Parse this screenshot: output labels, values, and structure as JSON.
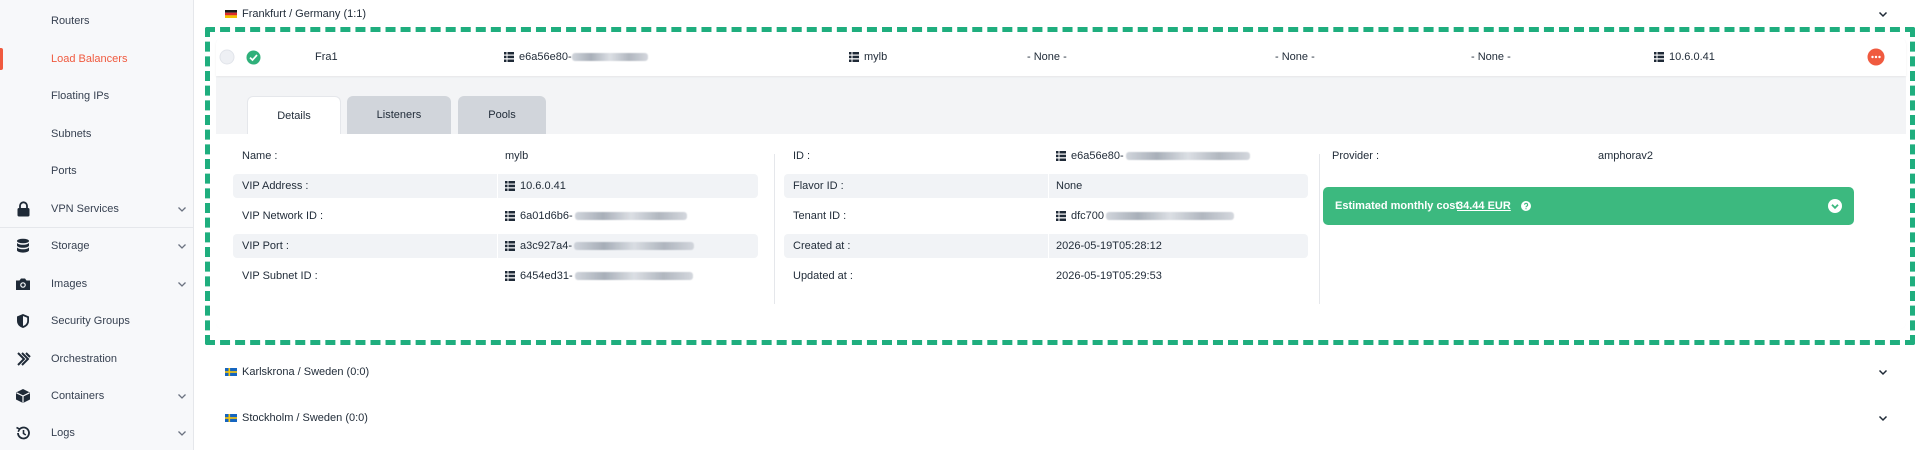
{
  "sidebar": {
    "items": [
      {
        "label": "Routers",
        "icon": "none"
      },
      {
        "label": "Load Balancers",
        "icon": "none",
        "active": true
      },
      {
        "label": "Floating IPs",
        "icon": "none"
      },
      {
        "label": "Subnets",
        "icon": "none"
      },
      {
        "label": "Ports",
        "icon": "none"
      },
      {
        "label": "VPN Services",
        "icon": "lock-icon",
        "expandable": true
      },
      {
        "label": "Storage",
        "icon": "database-icon",
        "expandable": true
      },
      {
        "label": "Images",
        "icon": "camera-icon",
        "expandable": true
      },
      {
        "label": "Security Groups",
        "icon": "shield-icon"
      },
      {
        "label": "Orchestration",
        "icon": "orchestration-icon"
      },
      {
        "label": "Containers",
        "icon": "box-icon",
        "expandable": true
      },
      {
        "label": "Logs",
        "icon": "history-icon",
        "expandable": true
      }
    ]
  },
  "regions": [
    {
      "label": "Frankfurt / Germany (1:1)",
      "flag": "germany-flag-icon",
      "expanded": true
    },
    {
      "label": "Karlskrona / Sweden (0:0)",
      "flag": "sweden-flag-icon"
    },
    {
      "label": "Stockholm / Sweden (0:0)",
      "flag": "sweden-flag-icon"
    }
  ],
  "lb_row": {
    "name": "Fra1",
    "id_prefix": "e6a56e80-",
    "lb_name": "mylb",
    "col4": "- None -",
    "col5": "- None -",
    "col6": "- None -",
    "ip": "10.6.0.41"
  },
  "tabs": [
    {
      "label": "Details",
      "active": true
    },
    {
      "label": "Listeners"
    },
    {
      "label": "Pools"
    }
  ],
  "details": {
    "left": [
      {
        "key": "Name :",
        "value": "mylb"
      },
      {
        "key": "VIP Address :",
        "value": "10.6.0.41"
      },
      {
        "key": "VIP Network ID :",
        "value": "6a01d6b6-"
      },
      {
        "key": "VIP Port :",
        "value": "a3c927a4-"
      },
      {
        "key": "VIP Subnet ID :",
        "value": "6454ed31-"
      }
    ],
    "middle": [
      {
        "key": "ID :",
        "value": "e6a56e80-"
      },
      {
        "key": "Flavor ID :",
        "value": "None"
      },
      {
        "key": "Tenant ID :",
        "value": "dfc700"
      },
      {
        "key": "Created at :",
        "value": "2026-05-19T05:28:12"
      },
      {
        "key": "Updated at :",
        "value": "2026-05-19T05:29:53"
      }
    ],
    "right": {
      "provider_key": "Provider :",
      "provider_value": "amphorav2",
      "cost_label": "Estimated monthly cost",
      "cost_value": "34.44 EUR"
    }
  },
  "colors": {
    "accent": "#f05a3f",
    "success": "#3cb97f",
    "frame": "#1fae7e"
  }
}
